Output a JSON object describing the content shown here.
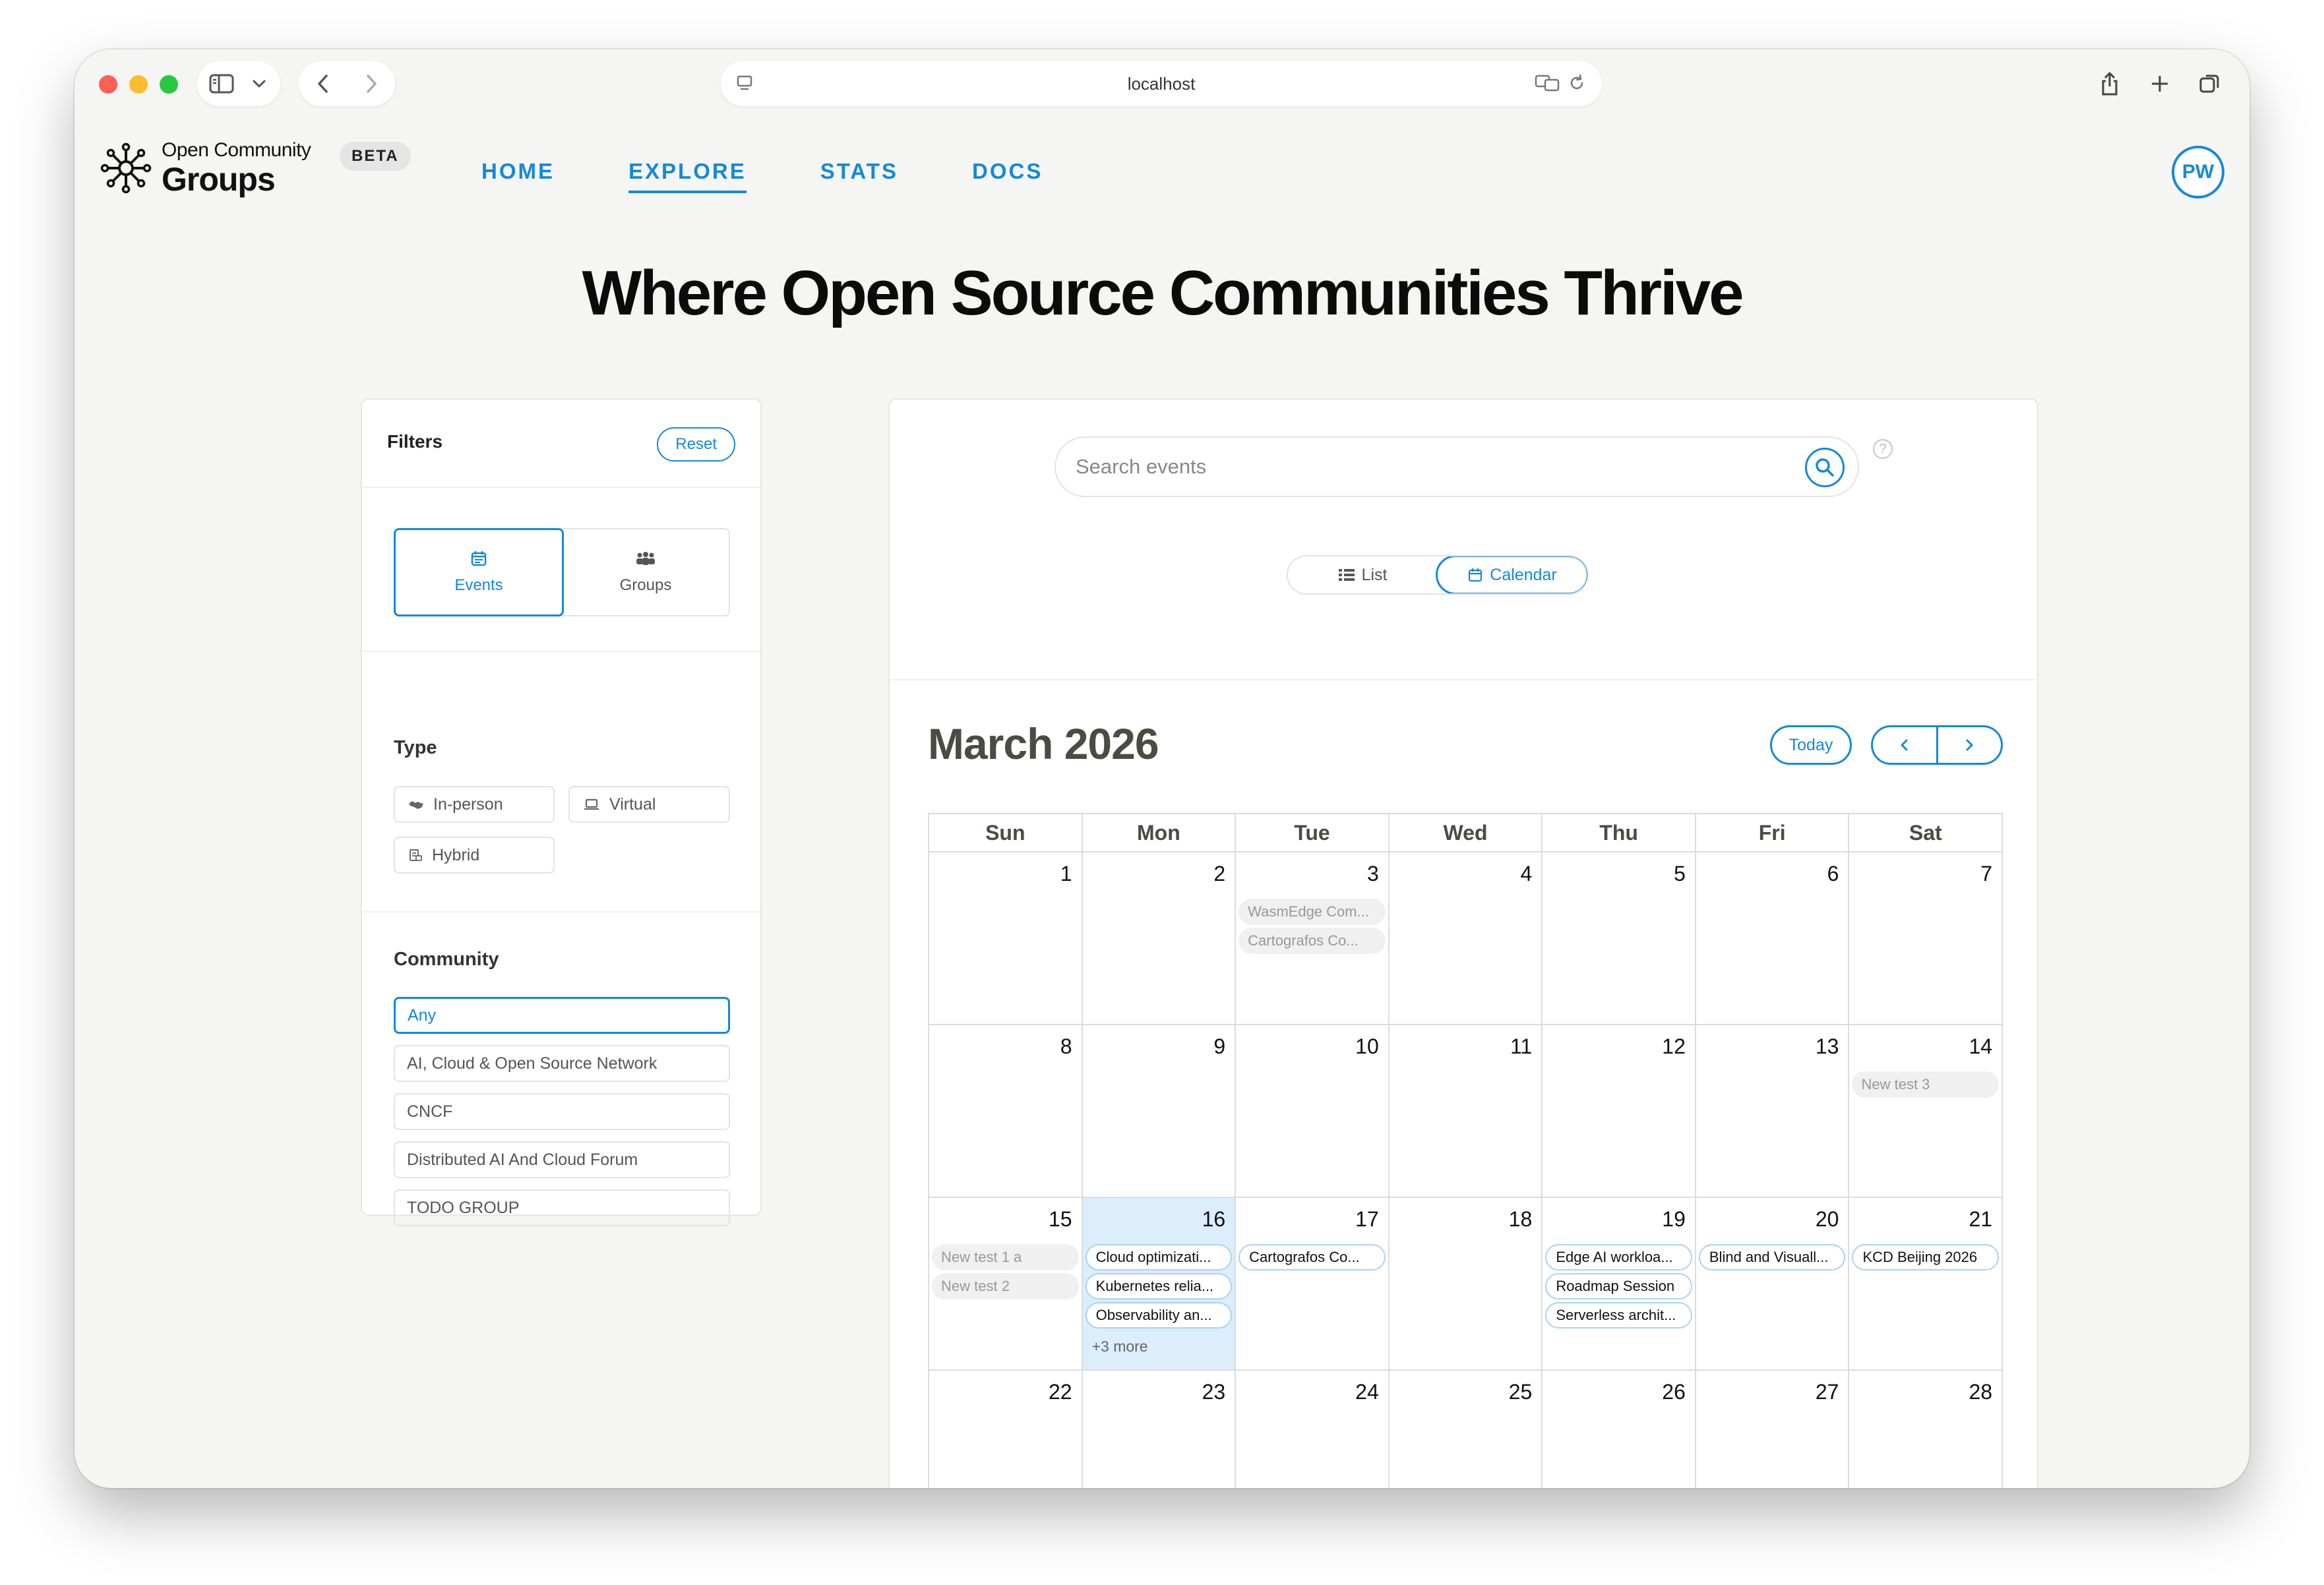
{
  "browser": {
    "url": "localhost"
  },
  "header": {
    "logo_top": "Open Community",
    "logo_bottom": "Groups",
    "badge": "BETA",
    "nav": [
      {
        "label": "HOME"
      },
      {
        "label": "EXPLORE"
      },
      {
        "label": "STATS"
      },
      {
        "label": "DOCS"
      }
    ],
    "active_nav": "EXPLORE",
    "avatar_initials": "PW"
  },
  "page": {
    "title": "Where Open Source Communities Thrive"
  },
  "filters": {
    "title": "Filters",
    "reset_label": "Reset",
    "tabs": [
      {
        "label": "Events",
        "icon": "calendar-icon"
      },
      {
        "label": "Groups",
        "icon": "people-icon"
      }
    ],
    "active_tab": "Events",
    "type_title": "Type",
    "types": [
      {
        "label": "In-person",
        "icon": "handshake-icon"
      },
      {
        "label": "Virtual",
        "icon": "laptop-icon"
      },
      {
        "label": "Hybrid",
        "icon": "hybrid-icon"
      }
    ],
    "community_title": "Community",
    "communities": [
      {
        "label": "Any"
      },
      {
        "label": "AI, Cloud & Open Source Network"
      },
      {
        "label": "CNCF"
      },
      {
        "label": "Distributed AI And Cloud Forum"
      },
      {
        "label": "TODO GROUP"
      }
    ],
    "active_community": "Any"
  },
  "search": {
    "placeholder": "Search events"
  },
  "view_toggle": {
    "list_label": "List",
    "calendar_label": "Calendar",
    "active": "Calendar"
  },
  "calendar": {
    "month_title": "March 2026",
    "today_label": "Today",
    "weekdays": [
      "Sun",
      "Mon",
      "Tue",
      "Wed",
      "Thu",
      "Fri",
      "Sat"
    ],
    "weeks": [
      [
        {
          "day": "1",
          "events": []
        },
        {
          "day": "2",
          "events": []
        },
        {
          "day": "3",
          "events": [
            {
              "title": "WasmEdge Com...",
              "past": true
            },
            {
              "title": "Cartografos Co...",
              "past": true
            }
          ]
        },
        {
          "day": "4",
          "events": []
        },
        {
          "day": "5",
          "events": []
        },
        {
          "day": "6",
          "events": []
        },
        {
          "day": "7",
          "events": []
        }
      ],
      [
        {
          "day": "8",
          "events": []
        },
        {
          "day": "9",
          "events": []
        },
        {
          "day": "10",
          "events": []
        },
        {
          "day": "11",
          "events": []
        },
        {
          "day": "12",
          "events": []
        },
        {
          "day": "13",
          "events": []
        },
        {
          "day": "14",
          "events": [
            {
              "title": "New test 3",
              "past": true
            }
          ]
        }
      ],
      [
        {
          "day": "15",
          "events": [
            {
              "title": "New test 1 a",
              "past": true
            },
            {
              "title": "New test 2",
              "past": true
            }
          ]
        },
        {
          "day": "16",
          "today": true,
          "events": [
            {
              "title": "Cloud optimizati...",
              "past": false
            },
            {
              "title": "Kubernetes relia...",
              "past": false
            },
            {
              "title": "Observability an...",
              "past": false
            }
          ],
          "more": "+3 more"
        },
        {
          "day": "17",
          "events": [
            {
              "title": "Cartografos Co...",
              "past": false
            }
          ]
        },
        {
          "day": "18",
          "events": []
        },
        {
          "day": "19",
          "events": [
            {
              "title": "Edge AI workloa...",
              "past": false
            },
            {
              "title": "Roadmap Session",
              "past": false
            },
            {
              "title": "Serverless archit...",
              "past": false
            }
          ]
        },
        {
          "day": "20",
          "events": [
            {
              "title": "Blind and Visuall...",
              "past": false
            }
          ]
        },
        {
          "day": "21",
          "events": [
            {
              "title": "KCD Beijing 2026",
              "past": false
            }
          ]
        }
      ],
      [
        {
          "day": "22",
          "events": []
        },
        {
          "day": "23",
          "events": []
        },
        {
          "day": "24",
          "events": []
        },
        {
          "day": "25",
          "events": []
        },
        {
          "day": "26",
          "events": []
        },
        {
          "day": "27",
          "events": []
        },
        {
          "day": "28",
          "events": []
        }
      ]
    ]
  },
  "colors": {
    "accent": "#1389d9",
    "today_bg": "#dcedfc",
    "page_bg": "#f5f5f4"
  }
}
